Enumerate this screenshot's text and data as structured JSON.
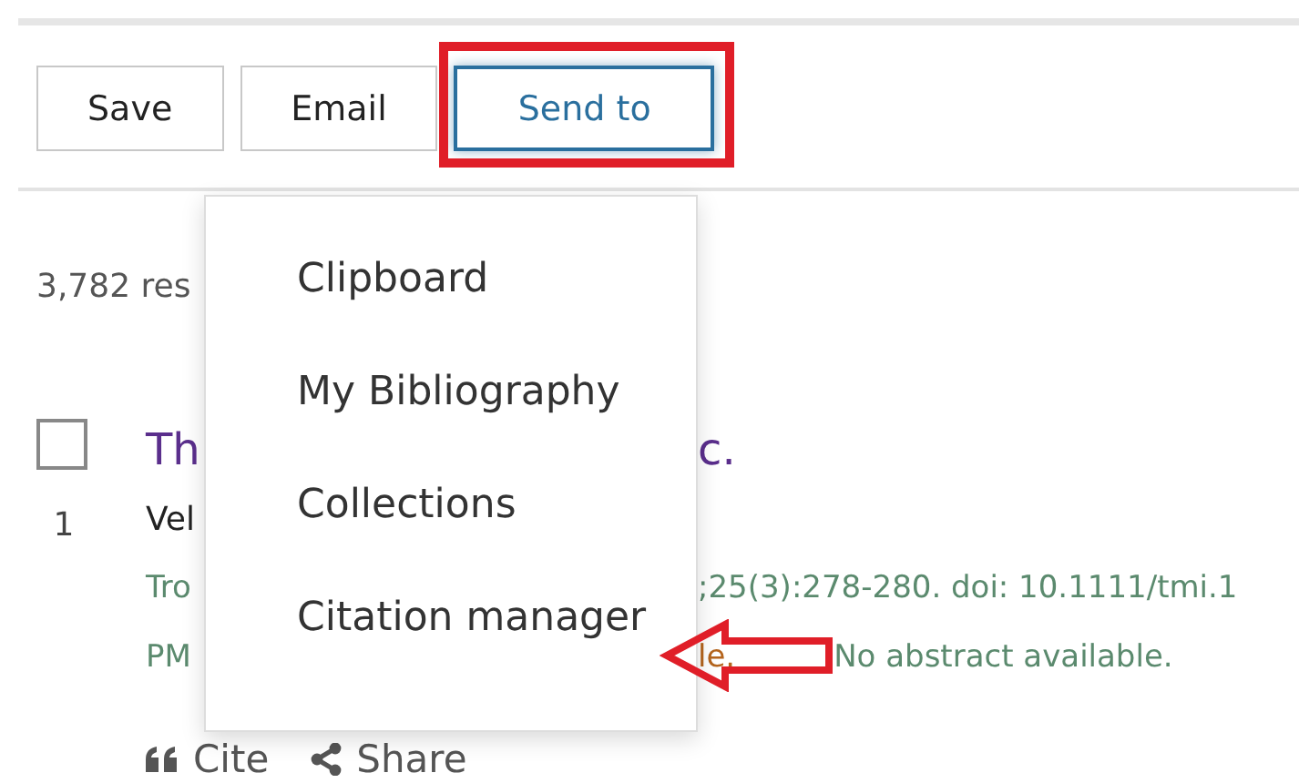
{
  "toolbar": {
    "buttons": [
      {
        "label": "Save",
        "selected": false
      },
      {
        "label": "Email",
        "selected": false
      },
      {
        "label": "Send to",
        "selected": true
      }
    ]
  },
  "results_count": "3,782 res",
  "result": {
    "checked": false,
    "number": "1",
    "title": [
      "Th",
      "c."
    ],
    "authors": "Vel",
    "citation": [
      "Tro",
      ";25(3):278-280. doi: 10.1111/tmi.1"
    ],
    "pmid_line": [
      "PM",
      "le.",
      "No abstract available."
    ],
    "actions": [
      {
        "kind": "cite",
        "label": "Cite"
      },
      {
        "kind": "share",
        "label": "Share"
      }
    ]
  },
  "menu": {
    "items": [
      "Clipboard",
      "My Bibliography",
      "Collections",
      "Citation manager"
    ]
  }
}
